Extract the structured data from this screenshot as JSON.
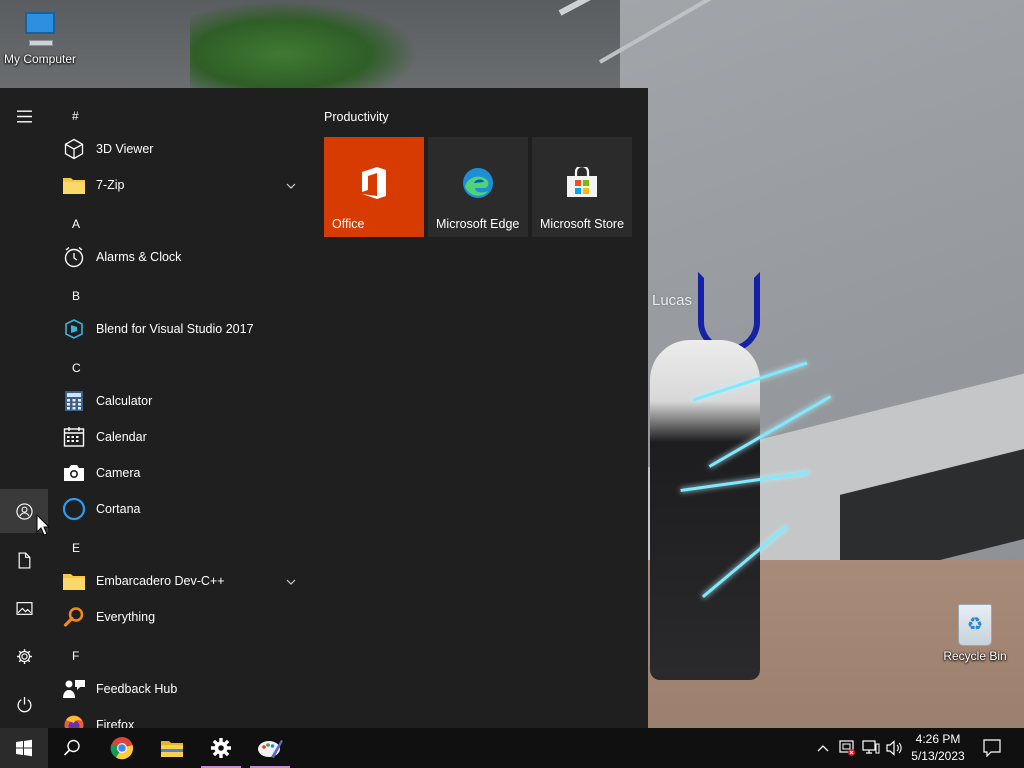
{
  "desktop": {
    "icons": [
      {
        "label": "My Computer",
        "icon": "computer-icon"
      },
      {
        "label": "Recycle Bin",
        "icon": "recycle-bin-icon"
      }
    ],
    "player_name": "Lucas"
  },
  "start_menu": {
    "rail": [
      {
        "name": "menu",
        "icon": "hamburger-icon"
      },
      {
        "name": "account",
        "icon": "user-icon"
      },
      {
        "name": "documents",
        "icon": "document-icon"
      },
      {
        "name": "pictures",
        "icon": "pictures-icon"
      },
      {
        "name": "settings",
        "icon": "gear-icon"
      },
      {
        "name": "power",
        "icon": "power-icon"
      }
    ],
    "letters": [
      "#",
      "A",
      "B",
      "C",
      "E",
      "F"
    ],
    "apps": [
      {
        "label": "3D Viewer",
        "icon": "cube-icon"
      },
      {
        "label": "7-Zip",
        "icon": "folder-icon",
        "expandable": true
      },
      {
        "label": "Alarms & Clock",
        "icon": "clock-icon"
      },
      {
        "label": "Blend for Visual Studio 2017",
        "icon": "blend-icon"
      },
      {
        "label": "Calculator",
        "icon": "calculator-icon"
      },
      {
        "label": "Calendar",
        "icon": "calendar-icon"
      },
      {
        "label": "Camera",
        "icon": "camera-icon"
      },
      {
        "label": "Cortana",
        "icon": "cortana-icon"
      },
      {
        "label": "Embarcadero Dev-C++",
        "icon": "folder-icon",
        "expandable": true
      },
      {
        "label": "Everything",
        "icon": "magnifier-icon"
      },
      {
        "label": "Feedback Hub",
        "icon": "feedback-icon"
      },
      {
        "label": "Firefox",
        "icon": "firefox-icon"
      }
    ],
    "tiles": {
      "group_title": "Productivity",
      "items": [
        {
          "label": "Office",
          "icon": "office-icon",
          "color": "#d83b01"
        },
        {
          "label": "Microsoft Edge",
          "icon": "edge-icon",
          "color": "#2b2b2b"
        },
        {
          "label": "Microsoft Store",
          "icon": "store-icon",
          "color": "#2b2b2b"
        }
      ]
    }
  },
  "taskbar": {
    "pinned": [
      {
        "name": "start",
        "icon": "windows-icon"
      },
      {
        "name": "search",
        "icon": "search-icon"
      },
      {
        "name": "chrome",
        "icon": "chrome-icon"
      },
      {
        "name": "file-explorer",
        "icon": "folder-icon"
      },
      {
        "name": "settings",
        "icon": "gear-icon"
      },
      {
        "name": "paint",
        "icon": "paint-icon"
      }
    ],
    "tray_icons": [
      "chevron-up-icon",
      "security-icon",
      "network-icon",
      "volume-icon"
    ],
    "clock": {
      "time": "4:26 PM",
      "date": "5/13/2023"
    },
    "notification_icon": "notification-icon"
  },
  "colors": {
    "menu_bg": "#1f1f1f",
    "taskbar_bg": "#101010",
    "office_tile": "#d83b01",
    "tile_bg": "#2b2b2b",
    "accent": "#0078d7"
  }
}
